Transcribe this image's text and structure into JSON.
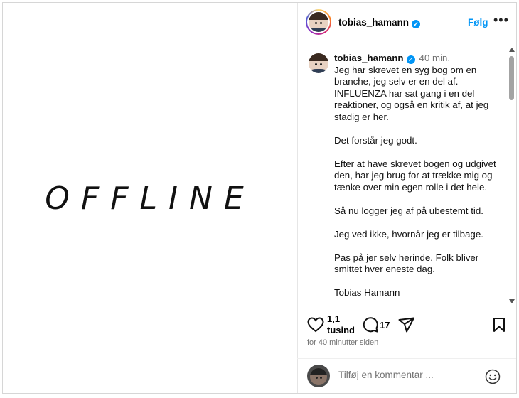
{
  "media": {
    "text": "OFFLINE"
  },
  "header": {
    "username": "tobias_hamann",
    "follow_label": "Følg",
    "more_label": "•••"
  },
  "caption": {
    "username": "tobias_hamann",
    "time": "40 min.",
    "paragraphs": [
      "Jeg har skrevet en syg bog om en branche, jeg selv er en del af. INFLUENZA har sat gang i en del reaktioner, og også en kritik af, at jeg stadig er her.",
      "Det forstår jeg godt.",
      "Efter at have skrevet bogen og udgivet den, har jeg brug for at trække mig og tænke over min egen rolle i det hele.",
      "Så nu logger jeg af på ubestemt tid.",
      "Jeg ved ikke, hvornår jeg er tilbage.",
      "Pas på jer selv herinde. Folk bliver smittet hver eneste dag.",
      "Tobias Hamann"
    ]
  },
  "actions": {
    "likes_line1": "1,1",
    "likes_line2": "tusind",
    "comments": "17",
    "posted_ago": "for 40 minutter siden"
  },
  "comment_box": {
    "placeholder": "Tilføj en kommentar ..."
  },
  "icons": [
    "heart-icon",
    "comment-icon",
    "share-icon",
    "bookmark-icon",
    "emoji-icon",
    "verified-icon",
    "more-icon"
  ],
  "colors": {
    "accent": "#0095f6",
    "muted": "#737373",
    "border": "#efefef"
  }
}
